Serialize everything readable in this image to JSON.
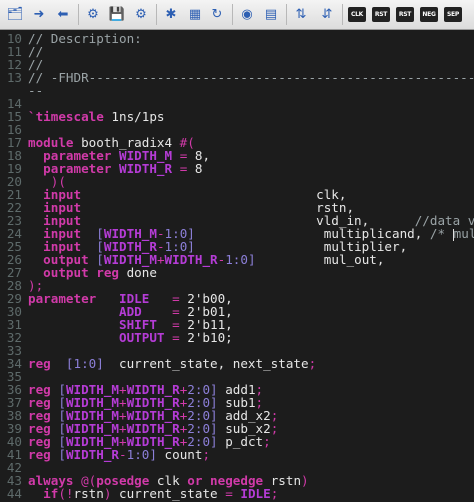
{
  "toolbar": {
    "buttons": [
      {
        "icon": "folder-tree-icon",
        "glyph": "🗂"
      },
      {
        "icon": "arrow-right-icon",
        "glyph": "➜"
      },
      {
        "icon": "arrow-left-icon",
        "glyph": "⬅"
      },
      {
        "icon": "settings-cog-icon",
        "glyph": "⚙"
      },
      {
        "icon": "save-icon",
        "glyph": "💾"
      },
      {
        "icon": "gears-icon",
        "glyph": "⚙"
      },
      {
        "icon": "run-icon",
        "glyph": "✱"
      },
      {
        "icon": "grid-icon",
        "glyph": "▦"
      },
      {
        "icon": "redo-icon",
        "glyph": "↻"
      },
      {
        "icon": "record-icon",
        "glyph": "◉"
      },
      {
        "icon": "calendar-icon",
        "glyph": "▤"
      },
      {
        "icon": "expand-icon",
        "glyph": "⇅"
      },
      {
        "icon": "collapse-icon",
        "glyph": "⇵"
      }
    ],
    "small_buttons": [
      "CLK",
      "RST",
      "RST",
      "NEG",
      "SEP"
    ]
  },
  "lines": [
    {
      "n": "10",
      "parts": [
        [
          "comment",
          "// Description:"
        ]
      ]
    },
    {
      "n": "11",
      "parts": [
        [
          "comment",
          "//"
        ]
      ]
    },
    {
      "n": "12",
      "parts": [
        [
          "comment",
          "//"
        ]
      ]
    },
    {
      "n": "13",
      "parts": [
        [
          "comment",
          "// -FHDR------------------------------------------------------------"
        ]
      ]
    },
    {
      "n": "",
      "parts": [
        [
          "comment",
          "--"
        ]
      ]
    },
    {
      "n": "14",
      "parts": []
    },
    {
      "n": "15",
      "parts": [
        [
          "kw",
          "`timescale"
        ],
        [
          "plain",
          " 1ns/1ps"
        ]
      ]
    },
    {
      "n": "16",
      "parts": []
    },
    {
      "n": "17",
      "parts": [
        [
          "kw",
          "module"
        ],
        [
          "plain",
          " booth_radix4 "
        ],
        [
          "op",
          "#("
        ]
      ]
    },
    {
      "n": "18",
      "parts": [
        [
          "plain",
          "  "
        ],
        [
          "kw",
          "parameter"
        ],
        [
          "plain",
          " "
        ],
        [
          "param",
          "WIDTH_M"
        ],
        [
          "plain",
          " "
        ],
        [
          "op",
          "="
        ],
        [
          "plain",
          " 8,"
        ]
      ]
    },
    {
      "n": "19",
      "parts": [
        [
          "plain",
          "  "
        ],
        [
          "kw",
          "parameter"
        ],
        [
          "plain",
          " "
        ],
        [
          "param",
          "WIDTH_R"
        ],
        [
          "plain",
          " "
        ],
        [
          "op",
          "="
        ],
        [
          "plain",
          " 8"
        ]
      ]
    },
    {
      "n": "20",
      "parts": [
        [
          "plain",
          "   "
        ],
        [
          "op",
          ")("
        ]
      ]
    },
    {
      "n": "21",
      "parts": [
        [
          "plain",
          "  "
        ],
        [
          "kw",
          "input"
        ],
        [
          "plain",
          "                               clk,"
        ]
      ]
    },
    {
      "n": "22",
      "parts": [
        [
          "plain",
          "  "
        ],
        [
          "kw",
          "input"
        ],
        [
          "plain",
          "                               rstn,"
        ]
      ]
    },
    {
      "n": "23",
      "parts": [
        [
          "plain",
          "  "
        ],
        [
          "kw",
          "input"
        ],
        [
          "plain",
          "                               vld_in,"
        ],
        [
          "comment",
          "      //data valid"
        ]
      ]
    },
    {
      "n": "24",
      "parts": [
        [
          "plain",
          "  "
        ],
        [
          "kw",
          "input"
        ],
        [
          "plain",
          "  "
        ],
        [
          "br",
          "["
        ],
        [
          "param",
          "WIDTH_M"
        ],
        [
          "op",
          "-"
        ],
        [
          "br",
          "1:0]"
        ],
        [
          "plain",
          "                 multiplicand, "
        ],
        [
          "comment",
          "/* "
        ],
        [
          "caret",
          ""
        ],
        [
          "comment",
          "mul*/"
        ]
      ]
    },
    {
      "n": "25",
      "parts": [
        [
          "plain",
          "  "
        ],
        [
          "kw",
          "input"
        ],
        [
          "plain",
          "  "
        ],
        [
          "br",
          "["
        ],
        [
          "param",
          "WIDTH_R"
        ],
        [
          "op",
          "-"
        ],
        [
          "br",
          "1:0]"
        ],
        [
          "plain",
          "                 multiplier,"
        ]
      ]
    },
    {
      "n": "26",
      "parts": [
        [
          "plain",
          "  "
        ],
        [
          "kw",
          "output"
        ],
        [
          "plain",
          " "
        ],
        [
          "br",
          "["
        ],
        [
          "param",
          "WIDTH_M"
        ],
        [
          "op",
          "+"
        ],
        [
          "param",
          "WIDTH_R"
        ],
        [
          "op",
          "-"
        ],
        [
          "br",
          "1:0]"
        ],
        [
          "plain",
          "         mul_out,"
        ]
      ]
    },
    {
      "n": "27",
      "parts": [
        [
          "plain",
          "  "
        ],
        [
          "kw",
          "output"
        ],
        [
          "plain",
          " "
        ],
        [
          "kw",
          "reg"
        ],
        [
          "plain",
          " done"
        ]
      ]
    },
    {
      "n": "28",
      "parts": [
        [
          "op",
          ");"
        ]
      ]
    },
    {
      "n": "29",
      "parts": [
        [
          "kw",
          "parameter"
        ],
        [
          "plain",
          "   "
        ],
        [
          "param",
          "IDLE"
        ],
        [
          "plain",
          "   "
        ],
        [
          "op",
          "="
        ],
        [
          "plain",
          " 2'b00,"
        ]
      ]
    },
    {
      "n": "30",
      "parts": [
        [
          "plain",
          "            "
        ],
        [
          "param",
          "ADD"
        ],
        [
          "plain",
          "    "
        ],
        [
          "op",
          "="
        ],
        [
          "plain",
          " 2'b01,"
        ]
      ]
    },
    {
      "n": "31",
      "parts": [
        [
          "plain",
          "            "
        ],
        [
          "param",
          "SHIFT"
        ],
        [
          "plain",
          "  "
        ],
        [
          "op",
          "="
        ],
        [
          "plain",
          " 2'b11,"
        ]
      ]
    },
    {
      "n": "32",
      "parts": [
        [
          "plain",
          "            "
        ],
        [
          "param",
          "OUTPUT"
        ],
        [
          "plain",
          " "
        ],
        [
          "op",
          "="
        ],
        [
          "plain",
          " 2'b10;"
        ]
      ]
    },
    {
      "n": "33",
      "parts": []
    },
    {
      "n": "34",
      "parts": [
        [
          "kw",
          "reg"
        ],
        [
          "plain",
          "  "
        ],
        [
          "br",
          "[1:0]"
        ],
        [
          "plain",
          "  current_state, next_state"
        ],
        [
          "op",
          ";"
        ]
      ]
    },
    {
      "n": "35",
      "parts": []
    },
    {
      "n": "36",
      "parts": [
        [
          "kw",
          "reg"
        ],
        [
          "plain",
          " "
        ],
        [
          "br",
          "["
        ],
        [
          "param",
          "WIDTH_M"
        ],
        [
          "op",
          "+"
        ],
        [
          "param",
          "WIDTH_R"
        ],
        [
          "op",
          "+"
        ],
        [
          "br",
          "2:0]"
        ],
        [
          "plain",
          " add1"
        ],
        [
          "op",
          ";"
        ]
      ]
    },
    {
      "n": "37",
      "parts": [
        [
          "kw",
          "reg"
        ],
        [
          "plain",
          " "
        ],
        [
          "br",
          "["
        ],
        [
          "param",
          "WIDTH_M"
        ],
        [
          "op",
          "+"
        ],
        [
          "param",
          "WIDTH_R"
        ],
        [
          "op",
          "+"
        ],
        [
          "br",
          "2:0]"
        ],
        [
          "plain",
          " sub1"
        ],
        [
          "op",
          ";"
        ]
      ]
    },
    {
      "n": "38",
      "parts": [
        [
          "kw",
          "reg"
        ],
        [
          "plain",
          " "
        ],
        [
          "br",
          "["
        ],
        [
          "param",
          "WIDTH_M"
        ],
        [
          "op",
          "+"
        ],
        [
          "param",
          "WIDTH_R"
        ],
        [
          "op",
          "+"
        ],
        [
          "br",
          "2:0]"
        ],
        [
          "plain",
          " add_x2"
        ],
        [
          "op",
          ";"
        ]
      ]
    },
    {
      "n": "39",
      "parts": [
        [
          "kw",
          "reg"
        ],
        [
          "plain",
          " "
        ],
        [
          "br",
          "["
        ],
        [
          "param",
          "WIDTH_M"
        ],
        [
          "op",
          "+"
        ],
        [
          "param",
          "WIDTH_R"
        ],
        [
          "op",
          "+"
        ],
        [
          "br",
          "2:0]"
        ],
        [
          "plain",
          " sub_x2"
        ],
        [
          "op",
          ";"
        ]
      ]
    },
    {
      "n": "40",
      "parts": [
        [
          "kw",
          "reg"
        ],
        [
          "plain",
          " "
        ],
        [
          "br",
          "["
        ],
        [
          "param",
          "WIDTH_M"
        ],
        [
          "op",
          "+"
        ],
        [
          "param",
          "WIDTH_R"
        ],
        [
          "op",
          "+"
        ],
        [
          "br",
          "2:0]"
        ],
        [
          "plain",
          " p_dct"
        ],
        [
          "op",
          ";"
        ]
      ]
    },
    {
      "n": "41",
      "parts": [
        [
          "kw",
          "reg"
        ],
        [
          "plain",
          " "
        ],
        [
          "br",
          "["
        ],
        [
          "param",
          "WIDTH_R"
        ],
        [
          "op",
          "-"
        ],
        [
          "br",
          "1:0]"
        ],
        [
          "plain",
          " count"
        ],
        [
          "op",
          ";"
        ]
      ]
    },
    {
      "n": "42",
      "parts": []
    },
    {
      "n": "43",
      "parts": [
        [
          "kw",
          "always"
        ],
        [
          "plain",
          " "
        ],
        [
          "op",
          "@("
        ],
        [
          "kw",
          "posedge"
        ],
        [
          "plain",
          " clk "
        ],
        [
          "kw",
          "or"
        ],
        [
          "plain",
          " "
        ],
        [
          "kw",
          "negedge"
        ],
        [
          "plain",
          " rstn"
        ],
        [
          "op",
          ")"
        ]
      ]
    },
    {
      "n": "44",
      "parts": [
        [
          "plain",
          "  "
        ],
        [
          "kw",
          "if"
        ],
        [
          "op",
          "(!"
        ],
        [
          "plain",
          "rstn"
        ],
        [
          "op",
          ")"
        ],
        [
          "plain",
          " current_state "
        ],
        [
          "op",
          "="
        ],
        [
          "plain",
          " "
        ],
        [
          "param",
          "IDLE"
        ],
        [
          "op",
          ";"
        ]
      ]
    }
  ]
}
